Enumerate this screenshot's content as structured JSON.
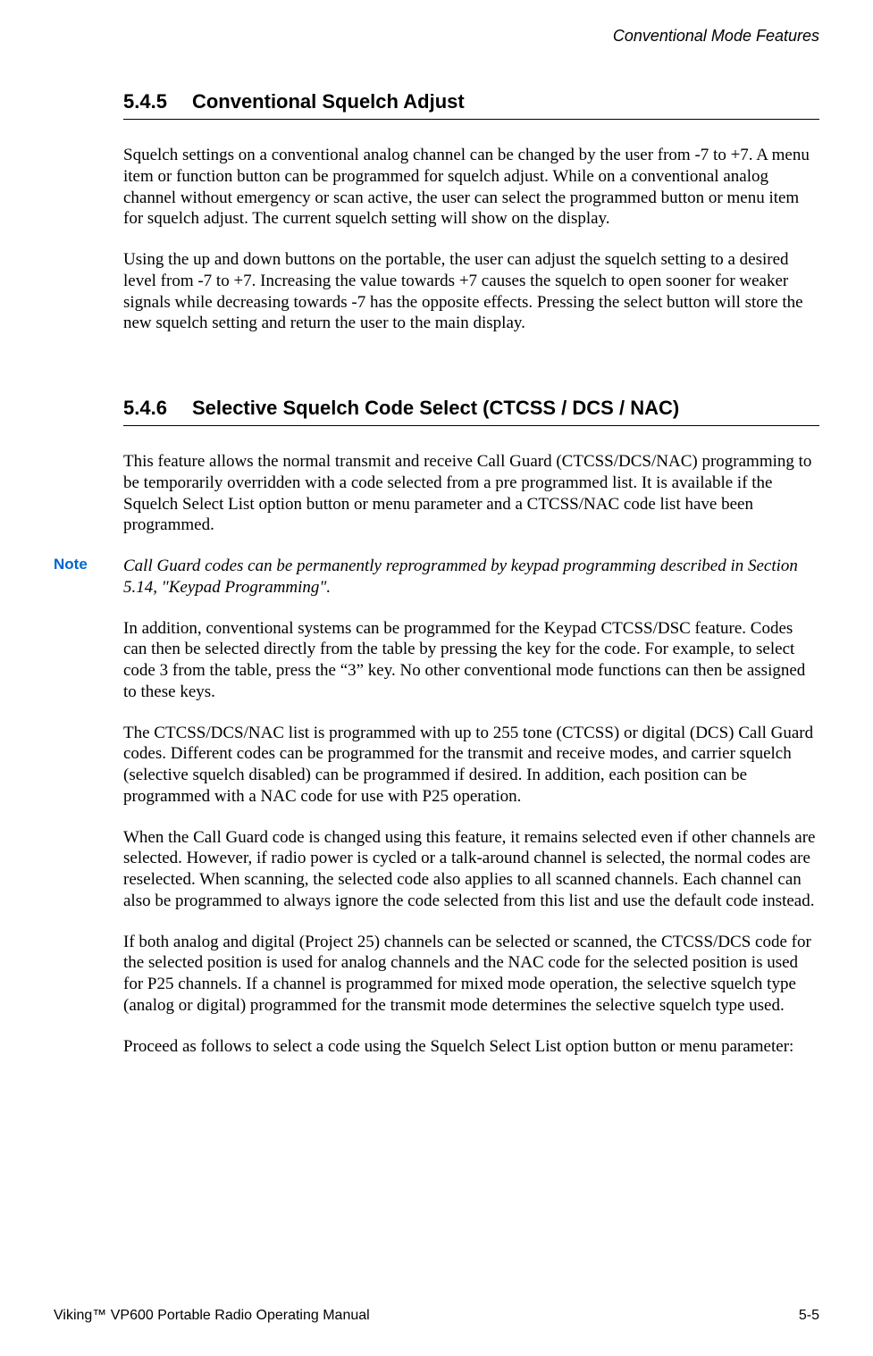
{
  "header": {
    "running_title": "Conventional Mode Features"
  },
  "sections": {
    "s545": {
      "number": "5.4.5",
      "title": "Conventional Squelch Adjust",
      "paragraphs": {
        "p1": "Squelch settings on a conventional analog channel can be changed by the user from -7 to +7. A menu item or function button can be programmed for squelch adjust. While on a conventional analog channel without emergency or scan active, the user can select the programmed button or menu item for squelch adjust. The current squelch setting will show on the display.",
        "p2": "Using the up and down buttons on the portable, the user can adjust the squelch setting to a desired level from -7 to +7. Increasing the value towards +7 causes the squelch to open sooner for weaker signals while decreasing towards -7 has the opposite effects. Pressing the select button will store the new squelch setting and return the user to the main display."
      }
    },
    "s546": {
      "number": "5.4.6",
      "title": "Selective Squelch Code Select (CTCSS / DCS / NAC)",
      "paragraphs": {
        "p1": "This feature allows the normal transmit and receive Call Guard (CTCSS/DCS/NAC) programming to be temporarily overridden with a code selected from a pre programmed list. It is available if the Squelch Select List option button or menu parameter and a CTCSS/NAC code list have been programmed.",
        "note_label": "Note",
        "note_text": "Call Guard codes can be permanently reprogrammed by keypad programming described in Section 5.14, \"Keypad Programming\".",
        "p2": "In addition, conventional systems can be programmed for the Keypad CTCSS/DSC feature. Codes can then be selected directly from the table by pressing the key for the code. For example, to select code 3 from the table, press the “3” key. No other conventional mode functions can then be assigned to these keys.",
        "p3": "The CTCSS/DCS/NAC list is programmed with up to 255 tone (CTCSS) or digital (DCS) Call Guard codes. Different codes can be programmed for the transmit and receive modes, and carrier squelch (selective squelch disabled) can be programmed if desired. In addition, each position can be programmed with a NAC code for use with P25 operation.",
        "p4": "When the Call Guard code is changed using this feature, it remains selected even if other channels are selected. However, if radio power is cycled or a talk-around channel is selected, the normal codes are reselected. When scanning, the selected code also applies to all scanned channels. Each channel can also be programmed to always ignore the code selected from this list and use the default code instead.",
        "p5": "If both analog and digital (Project 25) channels can be selected or scanned, the CTCSS/DCS code for the selected position is used for analog channels and the NAC code for the selected position is used for P25 channels. If a channel is programmed for mixed mode operation, the selective squelch type (analog or digital) programmed for the transmit mode determines the selective squelch type used.",
        "p6": "Proceed as follows to select a code using the Squelch Select List option button or menu parameter:"
      }
    }
  },
  "footer": {
    "left": "Viking™ VP600 Portable Radio Operating Manual",
    "right": "5-5"
  }
}
